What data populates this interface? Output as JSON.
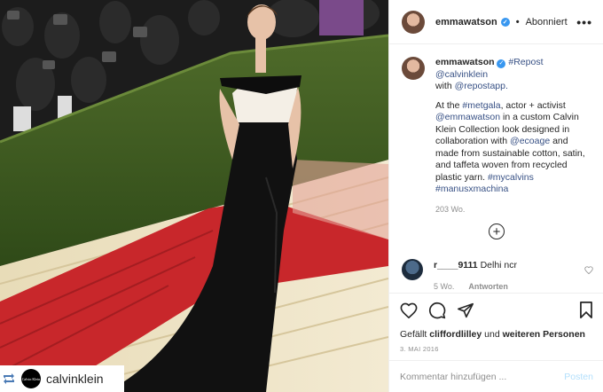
{
  "post": {
    "username": "emmawatson",
    "follow_state": "Abonniert",
    "more_label": "•••"
  },
  "caption": {
    "username": "emmawatson",
    "repost": "#Repost",
    "repost_user": "@calvinklein",
    "with_text": "with",
    "repostapp": "@repostapp.",
    "intro": "At the",
    "metgala": "#metgala",
    "line1_rest": ", actor + activist",
    "mention": "@emmawatson",
    "body": " in a custom Calvin Klein Collection look designed in collaboration with ",
    "ecoage": "@ecoage",
    "body2": " and made from sustainable cotton, satin, and taffeta woven from recycled plastic yarn. ",
    "tag1": "#mycalvins",
    "tag2": "#manusxmachina",
    "time": "203 Wo."
  },
  "comment": {
    "username": "r____9111",
    "text": "Delhi ncr",
    "age": "5 Wo.",
    "reply": "Antworten"
  },
  "likes": {
    "prefix": "Gefällt",
    "user": "cliffordlilley",
    "mid": "und",
    "rest": "weiteren Personen"
  },
  "date": "3. MAI 2016",
  "add_comment": {
    "placeholder": "Kommentar hinzufügen ...",
    "post_label": "Posten"
  },
  "photo_tag": {
    "name": "calvinklein",
    "avatar_text": "Calvin Klein"
  },
  "icons": [
    "verified-icon",
    "more-icon",
    "add-comments-icon",
    "heart-icon",
    "comment-icon",
    "share-icon",
    "bookmark-icon",
    "repost-icon"
  ]
}
